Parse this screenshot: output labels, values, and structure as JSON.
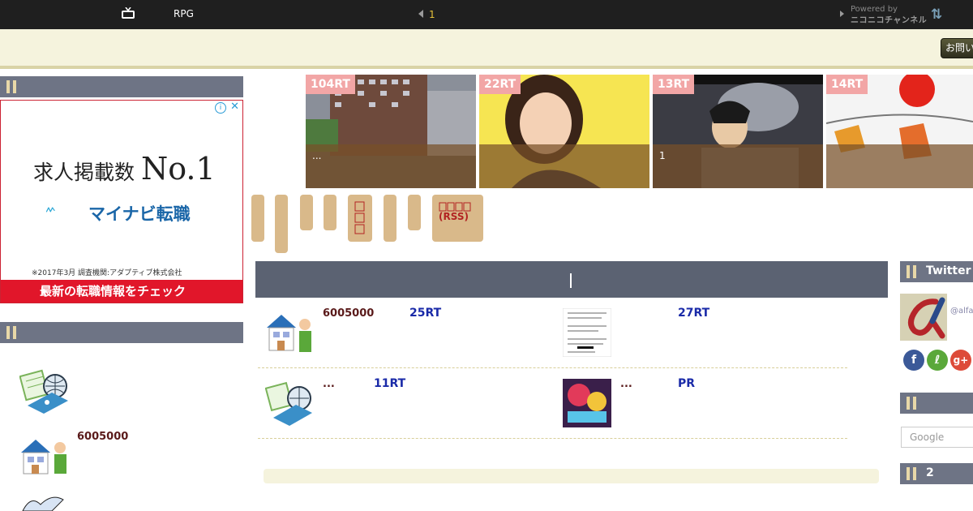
{
  "topbar": {
    "title": "RPG",
    "count": "1",
    "powered_by": "Powered by",
    "channel_brand": "ニコニコチャンネル"
  },
  "header": {
    "contact_label": "お問い"
  },
  "ad": {
    "headline_prefix": "求人掲載数",
    "headline_big": "No.1",
    "brand": "マイナビ転職",
    "footnote": "※2017年3月 調査機関:アダプティブ株式会社",
    "cta": "最新の転職情報をチェック"
  },
  "slider": [
    {
      "badge": "104RT",
      "caption": "..."
    },
    {
      "badge": "22RT",
      "caption": ""
    },
    {
      "badge": "13RT",
      "caption": "1"
    },
    {
      "badge": "14RT",
      "caption": ""
    }
  ],
  "tags": {
    "rss_label": "(RSS)"
  },
  "articles": [
    {
      "title": "6005000",
      "rt": "25RT"
    },
    {
      "title": "",
      "rt": "27RT"
    },
    {
      "title": "...",
      "rt": "11RT"
    },
    {
      "title": "...",
      "rt": "PR"
    }
  ],
  "left_sidebar": {
    "item_title": "6005000"
  },
  "right_sidebar": {
    "twitter_label": "Twitter",
    "handle": "@alfa",
    "search_placeholder": "Google",
    "section3_label": "2"
  },
  "colors": {
    "topbar": "#1f1f1f",
    "header_band": "#f5f3dd",
    "section_bar": "#6e7485",
    "main_header": "#5b6272",
    "badge": "#f2a6a6",
    "pill": "#d9b98a",
    "rt_link": "#1a2aa8",
    "ad_red": "#e1162a"
  }
}
